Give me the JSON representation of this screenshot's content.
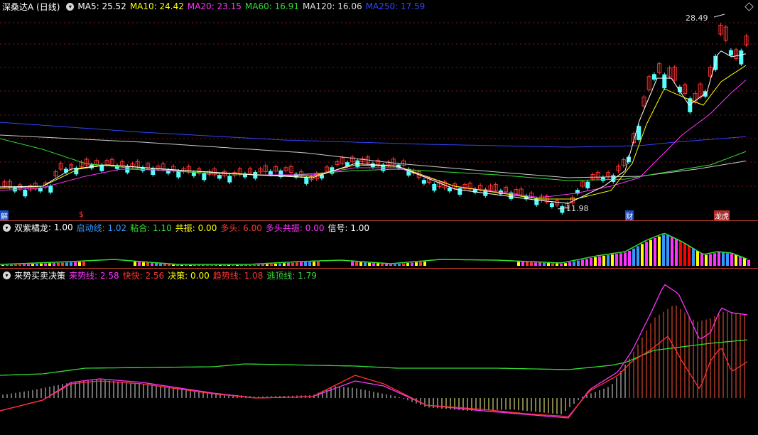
{
  "main": {
    "title": "深桑达A (日线)",
    "ma": [
      {
        "label": "MA5: 25.52",
        "color": "#ffffff"
      },
      {
        "label": "MA10: 24.42",
        "color": "#ffff00"
      },
      {
        "label": "MA20: 23.15",
        "color": "#ff33ff"
      },
      {
        "label": "MA60: 16.91",
        "color": "#33dd33"
      },
      {
        "label": "MA120: 16.06",
        "color": "#dddddd"
      },
      {
        "label": "MA250: 17.59",
        "color": "#3344ff"
      }
    ],
    "high_label": "28.49",
    "low_label": "11.98",
    "markers": {
      "left": "解",
      "s": "$",
      "cai": "财",
      "long_hu": "龙虎"
    }
  },
  "ind1": {
    "title": "双紫橘龙",
    "fields": [
      {
        "label": ": 1.00",
        "color": "#ffffff"
      },
      {
        "label": "启动线: 1.02",
        "color": "#3399ff"
      },
      {
        "label": "粘合: 1.10",
        "color": "#33dd33"
      },
      {
        "label": "共振: 0.00",
        "color": "#ffff00"
      },
      {
        "label": "多头: 6.00",
        "color": "#ff3333"
      },
      {
        "label": "多头共振: 0.00",
        "color": "#ff33ff"
      },
      {
        "label": "信号: 1.00",
        "color": "#ffffff"
      }
    ]
  },
  "ind2": {
    "title": "来势买卖决策",
    "fields": [
      {
        "label": "来势线: 2.58",
        "color": "#ff33ff"
      },
      {
        "label": "快快: 2.56",
        "color": "#ff3333"
      },
      {
        "label": "决策: 0.00",
        "color": "#ffff00"
      },
      {
        "label": "趋势线: 1.08",
        "color": "#ff3333"
      },
      {
        "label": "逃顶线: 1.79",
        "color": "#33dd33"
      }
    ]
  },
  "colors": {
    "up": "#ff3333",
    "down": "#54ffff",
    "grid": "#7a1a1a",
    "separator": "#c0392b"
  }
}
